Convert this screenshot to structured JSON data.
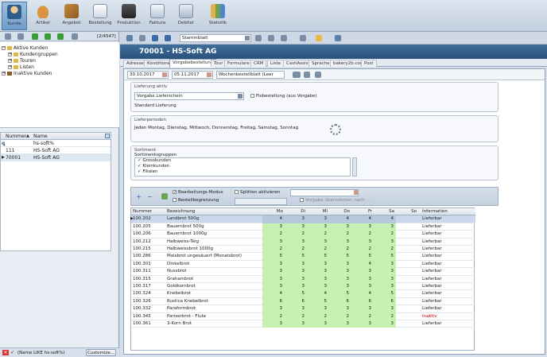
{
  "ribbon": {
    "buttons": [
      {
        "label": "Kunde",
        "icon": "person-icon"
      },
      {
        "label": "Artikel",
        "icon": "bread-icon"
      },
      {
        "label": "Angebot",
        "icon": "offer-icon"
      },
      {
        "label": "Bestellung",
        "icon": "order-icon"
      },
      {
        "label": "Produktion",
        "icon": "production-icon"
      },
      {
        "label": "Faktura",
        "icon": "invoice-icon"
      },
      {
        "label": "Debitor",
        "icon": "debitor-icon"
      },
      {
        "label": "Statistik",
        "icon": "statistics-icon"
      }
    ]
  },
  "left": {
    "counter": "[2/4547]",
    "tree": [
      {
        "label": "Aktive Kunden",
        "level": 0
      },
      {
        "label": "Kundengruppen",
        "level": 1
      },
      {
        "label": "Touren",
        "level": 1
      },
      {
        "label": "Listen",
        "level": 1
      },
      {
        "label": "Inaktive Kunden",
        "level": 0
      }
    ],
    "grid_headers": {
      "number": "Nummer",
      "name": "Name"
    },
    "filter_row": {
      "name": "hs-soft%"
    },
    "rows": [
      {
        "number": "111",
        "name": "HS-Soft AG"
      },
      {
        "number": "70001",
        "name": "HS-Soft AG"
      }
    ],
    "filter_text": "(Name LIKE hs-soft%)",
    "customize_label": "Customize..."
  },
  "main": {
    "search_value": "Stammblatt",
    "title": "70001 - HS-Soft AG",
    "tabs": [
      "Adresse",
      "Konditionen",
      "Vorgabebestellung",
      "Tour",
      "Formulare",
      "CRM",
      "Liste",
      "CashAssist",
      "Sprache",
      "bakery2b.com",
      "Post"
    ],
    "active_tab": "Vorgabebestellung",
    "date_from": "30.10.2017",
    "date_to": "05.11.2017",
    "view_select": "Wochenbestellblatt (Leer Menge)",
    "delivery": {
      "title": "Lieferung aktiv",
      "value": "Vorgabe Lieferschein",
      "fix_label": "Fixbestellung (aus Vorgabe)",
      "standard": "Standard Lieferung"
    },
    "periods": {
      "title": "Lieferperioden",
      "text": "Jeden Montag, Dienstag, Mittwoch, Donnerstag, Freitag, Samstag, Sonntag"
    },
    "sortiment": {
      "title": "Sortiment",
      "subtitle": "Sortimentsgruppen",
      "items": [
        "Grosskunden",
        "Kleinkunden",
        "Filialen"
      ]
    },
    "toolbar": {
      "edit_mode": "Bearbeitungs-Modus",
      "order_limit": "Bestellbegrenzung",
      "split": "Splitten aktivieren",
      "apply": "Vorgabe übernehmen nach ..."
    },
    "grid": {
      "headers": [
        "Nummer",
        "Bezeichnung",
        "Mo",
        "Di",
        "Mi",
        "Do",
        "Fr",
        "Sa",
        "So",
        "Information"
      ],
      "rows": [
        {
          "nr": "100.202",
          "name": "Landbrot 500g",
          "v": [
            "4",
            "3",
            "3",
            "4",
            "4",
            "4",
            ""
          ],
          "info": "Lieferbar"
        },
        {
          "nr": "100.205",
          "name": "Bauernbrot 500g",
          "v": [
            "3",
            "3",
            "3",
            "3",
            "3",
            "3",
            ""
          ],
          "info": "Lieferbar"
        },
        {
          "nr": "100.206",
          "name": "Bauernbrot 1000g",
          "v": [
            "2",
            "2",
            "2",
            "2",
            "2",
            "2",
            ""
          ],
          "info": "Lieferbar"
        },
        {
          "nr": "100.212",
          "name": "Halbweiss-Teig",
          "v": [
            "3",
            "3",
            "3",
            "3",
            "3",
            "3",
            ""
          ],
          "info": "Lieferbar"
        },
        {
          "nr": "100.215",
          "name": "Halbweissbrot 1000g",
          "v": [
            "2",
            "2",
            "2",
            "2",
            "2",
            "2",
            ""
          ],
          "info": "Lieferbar"
        },
        {
          "nr": "100.286",
          "name": "Maisbrot ungesäuert (Monatsbrot)",
          "v": [
            "5",
            "5",
            "5",
            "5",
            "5",
            "5",
            ""
          ],
          "info": "Lieferbar"
        },
        {
          "nr": "100.301",
          "name": "Dinkelbrot",
          "v": [
            "3",
            "3",
            "3",
            "3",
            "4",
            "3",
            ""
          ],
          "info": "Lieferbar"
        },
        {
          "nr": "100.311",
          "name": "Nussbrot",
          "v": [
            "3",
            "3",
            "3",
            "3",
            "3",
            "3",
            ""
          ],
          "info": "Lieferbar"
        },
        {
          "nr": "100.315",
          "name": "Grahambrot",
          "v": [
            "3",
            "3",
            "3",
            "3",
            "3",
            "3",
            ""
          ],
          "info": "Lieferbar"
        },
        {
          "nr": "100.317",
          "name": "Goldkornbrot",
          "v": [
            "3",
            "3",
            "3",
            "3",
            "3",
            "3",
            ""
          ],
          "info": "Lieferbar"
        },
        {
          "nr": "100.324",
          "name": "Knebelbrot",
          "v": [
            "4",
            "5",
            "4",
            "5",
            "4",
            "5",
            ""
          ],
          "info": "Lieferbar"
        },
        {
          "nr": "100.326",
          "name": "Rustica Knebelbrot",
          "v": [
            "6",
            "6",
            "5",
            "6",
            "6",
            "6",
            ""
          ],
          "info": "Lieferbar"
        },
        {
          "nr": "100.332",
          "name": "Paraformbrot",
          "v": [
            "3",
            "3",
            "3",
            "3",
            "3",
            "3",
            ""
          ],
          "info": "Lieferbar"
        },
        {
          "nr": "100.345",
          "name": "Pariserbrot - Flute",
          "v": [
            "2",
            "2",
            "2",
            "2",
            "2",
            "2",
            ""
          ],
          "info": "Inaktiv"
        },
        {
          "nr": "100.361",
          "name": "3-Korn Brot",
          "v": [
            "3",
            "3",
            "3",
            "3",
            "3",
            "3",
            ""
          ],
          "info": "Lieferbar"
        }
      ]
    }
  },
  "colors": {
    "green": "#c6efb2",
    "title_bg": "#2f5d8a",
    "inactive": "#cc0000",
    "selected_row": "#c9d8ea"
  }
}
